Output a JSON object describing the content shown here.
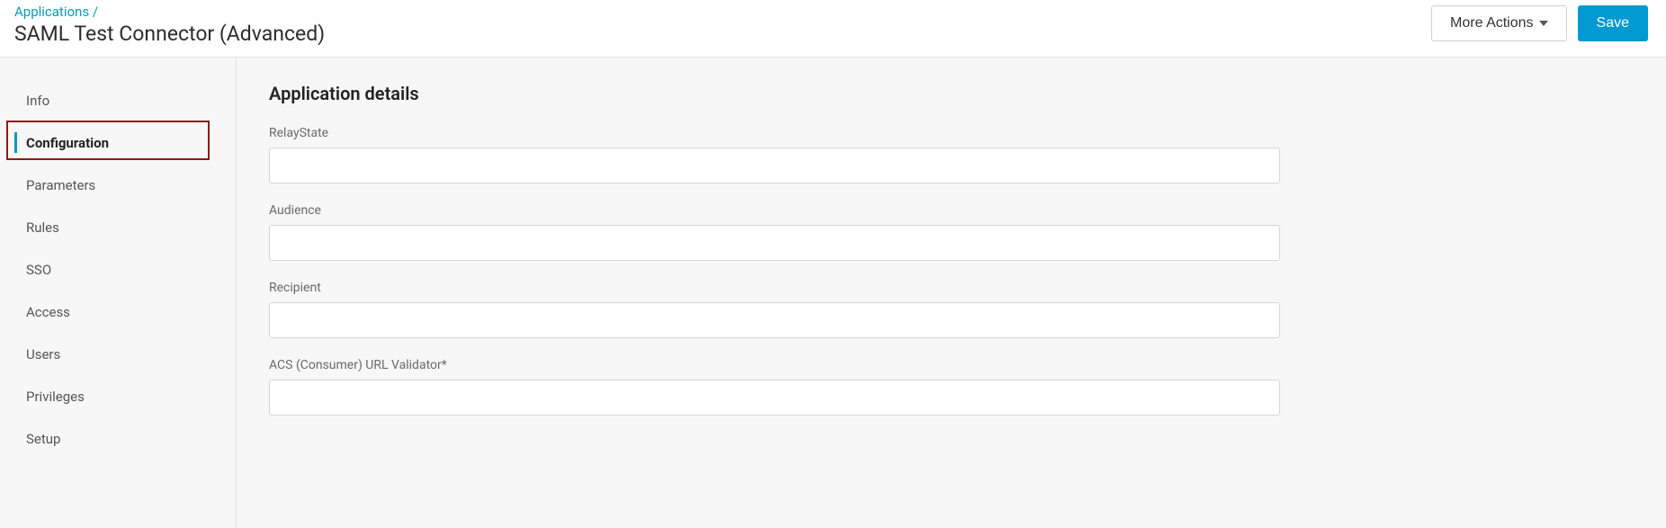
{
  "breadcrumb": {
    "root": "Applications",
    "sep": "/"
  },
  "page_title": "SAML Test Connector (Advanced)",
  "actions": {
    "more": "More Actions",
    "save": "Save"
  },
  "sidebar": {
    "items": [
      {
        "label": "Info"
      },
      {
        "label": "Configuration"
      },
      {
        "label": "Parameters"
      },
      {
        "label": "Rules"
      },
      {
        "label": "SSO"
      },
      {
        "label": "Access"
      },
      {
        "label": "Users"
      },
      {
        "label": "Privileges"
      },
      {
        "label": "Setup"
      }
    ],
    "active_index": 1
  },
  "main": {
    "section_title": "Application details",
    "fields": [
      {
        "label": "RelayState",
        "value": ""
      },
      {
        "label": "Audience",
        "value": ""
      },
      {
        "label": "Recipient",
        "value": ""
      },
      {
        "label": "ACS (Consumer) URL Validator*",
        "value": ""
      }
    ]
  }
}
